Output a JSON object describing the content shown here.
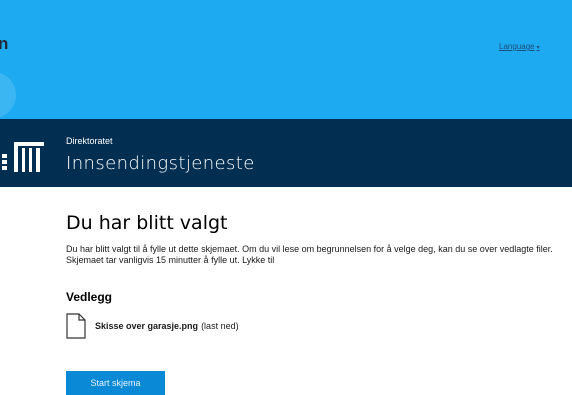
{
  "header": {
    "logo_partial_text": "n",
    "language_label": "Language",
    "language_caret": "▾"
  },
  "service_band": {
    "organization": "Direktoratet",
    "service_name": "Innsendingstjeneste"
  },
  "main": {
    "title": "Du har blitt valgt",
    "intro": "Du har blitt valgt til å fylle ut dette skjemaet. Om du vil lese om begrunnelsen for å velge deg, kan du se over vedlagte filer. Skjemaet tar vanligvis 15 minutter å fylle ut. Lykke til",
    "attachments_heading": "Vedlegg",
    "attachments": [
      {
        "file_name": "Skisse over garasje.png",
        "download_label": "(last ned)"
      }
    ],
    "start_button": "Start skjema"
  },
  "colors": {
    "topbar": "#1eaaf0",
    "band": "#022f51",
    "button": "#0a8ad6"
  }
}
